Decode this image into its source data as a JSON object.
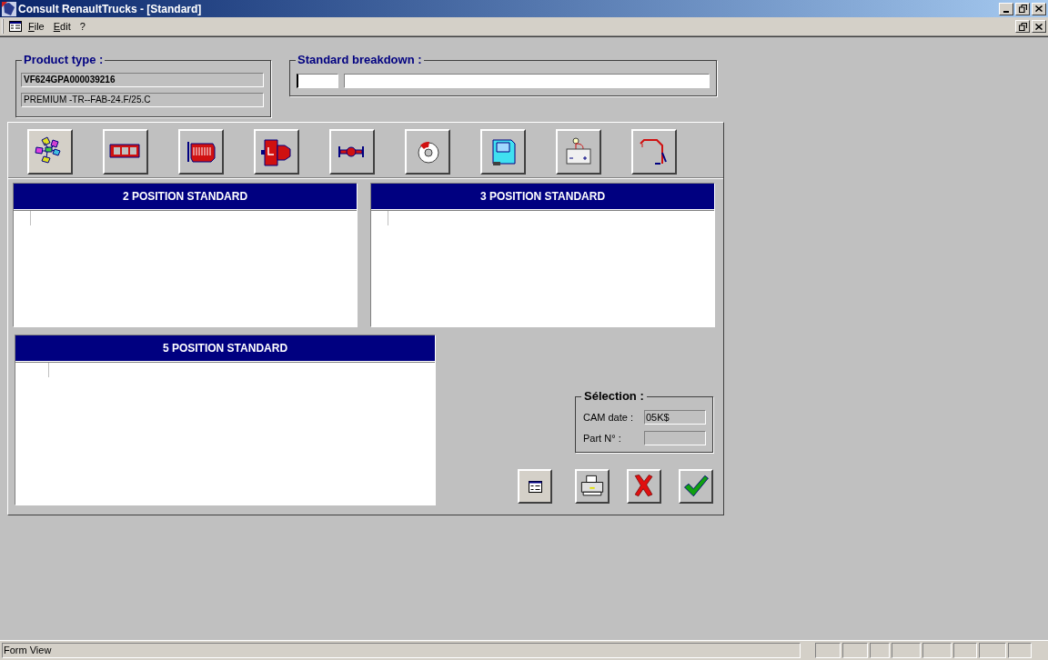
{
  "window": {
    "title": "Consult RenaultTrucks - [Standard]"
  },
  "menu": [
    "File",
    "Edit",
    "?"
  ],
  "product_type": {
    "title": "Product type :",
    "code": "VF624GPA000039216",
    "model": "PREMIUM -TR--FAB-24.F/25.C"
  },
  "standard_breakdown": {
    "title": "Standard breakdown :"
  },
  "categories": [
    {
      "kind": "general",
      "selected": true
    },
    {
      "kind": "chassis",
      "selected": false
    },
    {
      "kind": "engine",
      "selected": false
    },
    {
      "kind": "gearbox",
      "selected": false
    },
    {
      "kind": "axle",
      "selected": false
    },
    {
      "kind": "brake",
      "selected": false
    },
    {
      "kind": "cab",
      "selected": false
    },
    {
      "kind": "electrical",
      "selected": false
    },
    {
      "kind": "crane",
      "selected": false
    }
  ],
  "lists": [
    {
      "title": "2 POSITION STANDARD"
    },
    {
      "title": "3 POSITION STANDARD"
    },
    {
      "title": "5 POSITION STANDARD"
    }
  ],
  "selection": {
    "title": "Sélection :",
    "fields": [
      {
        "label": "CAM date :",
        "value": "05K$"
      },
      {
        "label": "Part N° :"
      }
    ]
  },
  "actions": [
    {
      "kind": "form"
    },
    {
      "kind": "print"
    },
    {
      "kind": "cancel"
    },
    {
      "kind": "ok"
    }
  ],
  "status_bar": {
    "text": "Form View"
  }
}
